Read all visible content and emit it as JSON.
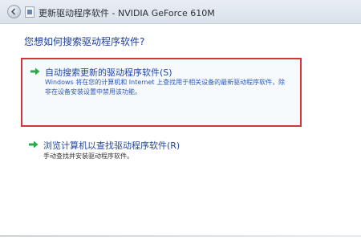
{
  "window": {
    "title": "更新驱动程序软件 - NVIDIA GeForce 610M"
  },
  "main": {
    "question": "您想如何搜索驱动程序软件?",
    "options": [
      {
        "title": "自动搜索更新的驱动程序软件(S)",
        "description": "Windows 将在您的计算机和 Internet 上查找用于相关设备的最新驱动程序软件，除非在设备安装设置中禁用该功能。",
        "icon": "green-arrow-icon",
        "highlighted": true
      },
      {
        "title": "浏览计算机以查找驱动程序软件(R)",
        "description": "手动查找并安装驱动程序软件。",
        "icon": "green-arrow-icon",
        "highlighted": false
      }
    ]
  },
  "colors": {
    "highlight_border": "#d6343b",
    "link_blue": "#2347a4",
    "arrow_green": "#2fa84f"
  }
}
